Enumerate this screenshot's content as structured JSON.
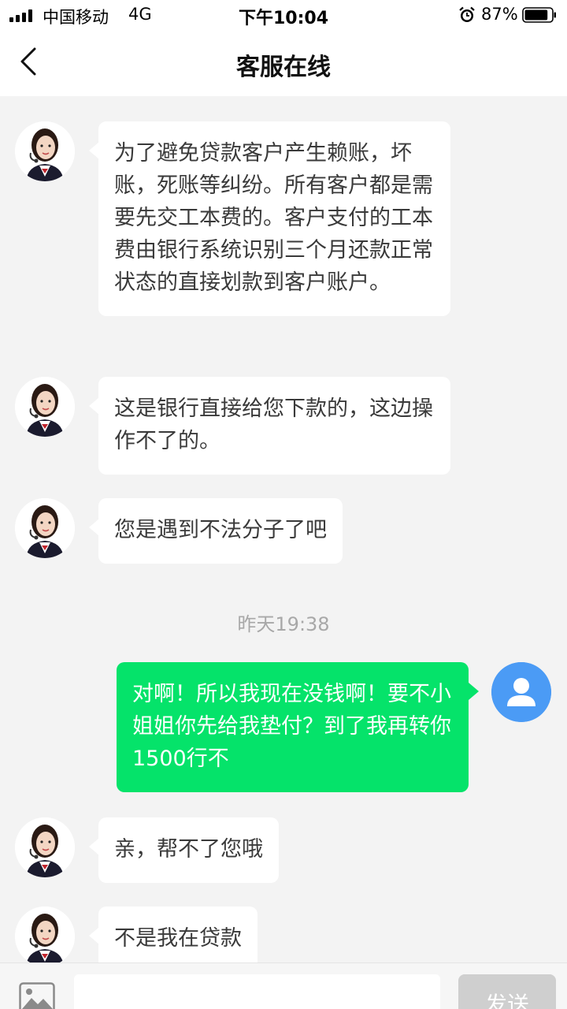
{
  "status_bar": {
    "carrier": "中国移动",
    "network": "4G",
    "time": "下午10:04",
    "battery": "87%",
    "battery_level": 0.87,
    "icons": [
      "signal-icon",
      "alarm-icon",
      "battery-icon"
    ]
  },
  "nav": {
    "title": "客服在线",
    "back_icon": "chevron-left-icon"
  },
  "messages": [
    {
      "from": "agent",
      "text": "为了避免贷款客户产生赖账，坏账，死账等纠纷。所有客户都是需要先交工本费的。客户支付的工本费由银行系统识别三个月还款正常状态的直接划款到客户账户。"
    },
    {
      "from": "agent",
      "text": "这是银行直接给您下款的，这边操作不了的。"
    },
    {
      "from": "agent",
      "text": "您是遇到不法分子了吧"
    },
    {
      "timestamp": "昨天19:38"
    },
    {
      "from": "user",
      "text": "对啊！所以我现在没钱啊！要不小姐姐你先给我垫付？到了我再转你1500行不"
    },
    {
      "from": "agent",
      "text": "亲，帮不了您哦"
    },
    {
      "from": "agent",
      "text": "不是我在贷款"
    }
  ],
  "input_bar": {
    "image_icon": "image-icon",
    "placeholder": "",
    "send_label": "发送"
  },
  "colors": {
    "user_bubble": "#05e36a",
    "agent_bubble": "#ffffff",
    "background": "#f3f3f3",
    "user_avatar": "#4b9bf5",
    "send_button": "#cfcfcf"
  }
}
